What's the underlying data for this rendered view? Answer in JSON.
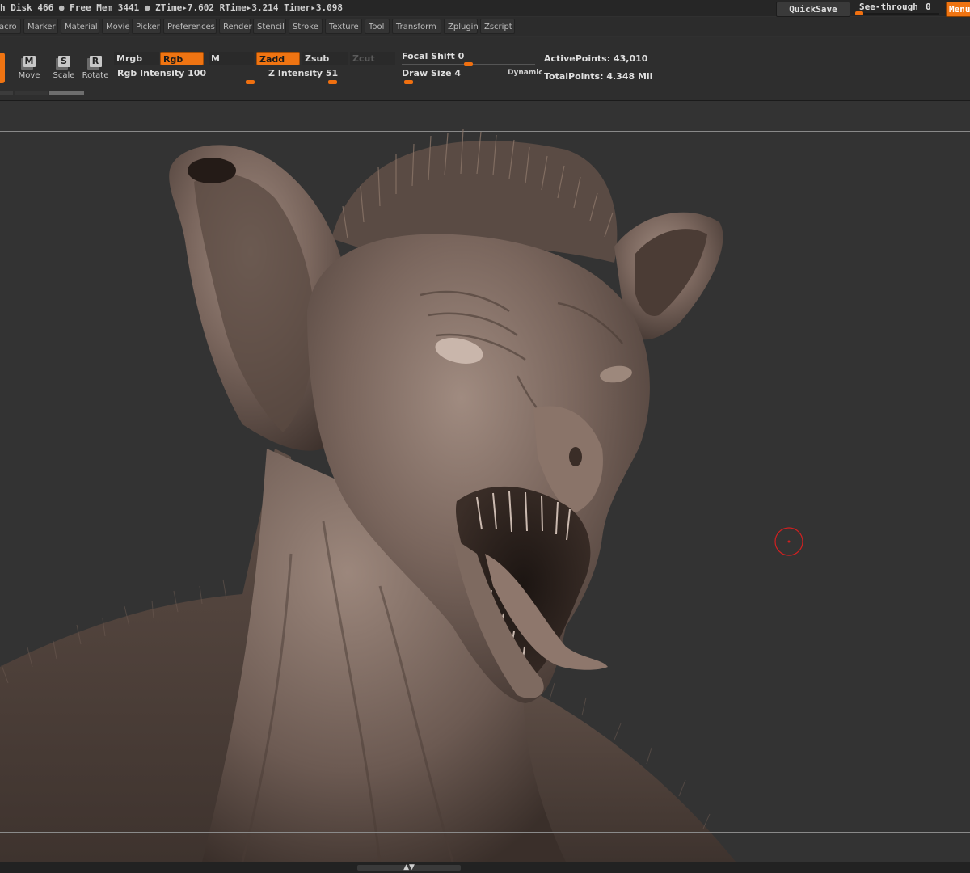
{
  "status": {
    "disk_label": "h Disk",
    "disk_value": "466",
    "mem_label": "Free Mem",
    "mem_value": "3441",
    "ztime_label": "ZTime",
    "ztime_value": "7.602",
    "rtime_label": "RTime",
    "rtime_value": "3.214",
    "timer_label": "Timer",
    "timer_value": "3.098",
    "separator": "●",
    "arrow": "▸"
  },
  "top_right": {
    "quicksave": "QuickSave",
    "seethrough_label": "See-through",
    "seethrough_value": "0",
    "seethrough_level": 0,
    "menus": "Menus"
  },
  "menubar": {
    "items": [
      "acro",
      "Marker",
      "Material",
      "Movie",
      "Picker",
      "Preferences",
      "Render",
      "Stencil",
      "Stroke",
      "Texture",
      "Tool",
      "Transform",
      "Zplugin",
      "Zscript"
    ]
  },
  "toolbar": {
    "tools": [
      {
        "glyph": "M",
        "label": "Move"
      },
      {
        "glyph": "S",
        "label": "Scale"
      },
      {
        "glyph": "R",
        "label": "Rotate"
      }
    ],
    "mrgb": "Mrgb",
    "rgb": "Rgb",
    "m": "M",
    "zadd": "Zadd",
    "zsub": "Zsub",
    "zcut": "Zcut",
    "rgb_intensity_label": "Rgb  Intensity",
    "rgb_intensity_value": "100",
    "rgb_intensity_level": 1.0,
    "z_intensity_label": "Z  Intensity",
    "z_intensity_value": "51",
    "z_intensity_level": 0.51,
    "focal_shift_label": "Focal  Shift",
    "focal_shift_value": "0",
    "focal_shift_level": 0.5,
    "draw_size_label": "Draw  Size",
    "draw_size_value": "4",
    "draw_size_level": 0.02,
    "dynamic": "Dynamic",
    "active_points_label": "ActivePoints:",
    "active_points_value": "43,010",
    "total_points_label": "TotalPoints:",
    "total_points_value": "4.348  Mil"
  },
  "colors": {
    "accent": "#ef7412",
    "background": "#333333",
    "model_clay": "#7a665d",
    "cursor": "#d22020"
  },
  "canvas": {
    "subject": "creature-bust-sculpt"
  }
}
